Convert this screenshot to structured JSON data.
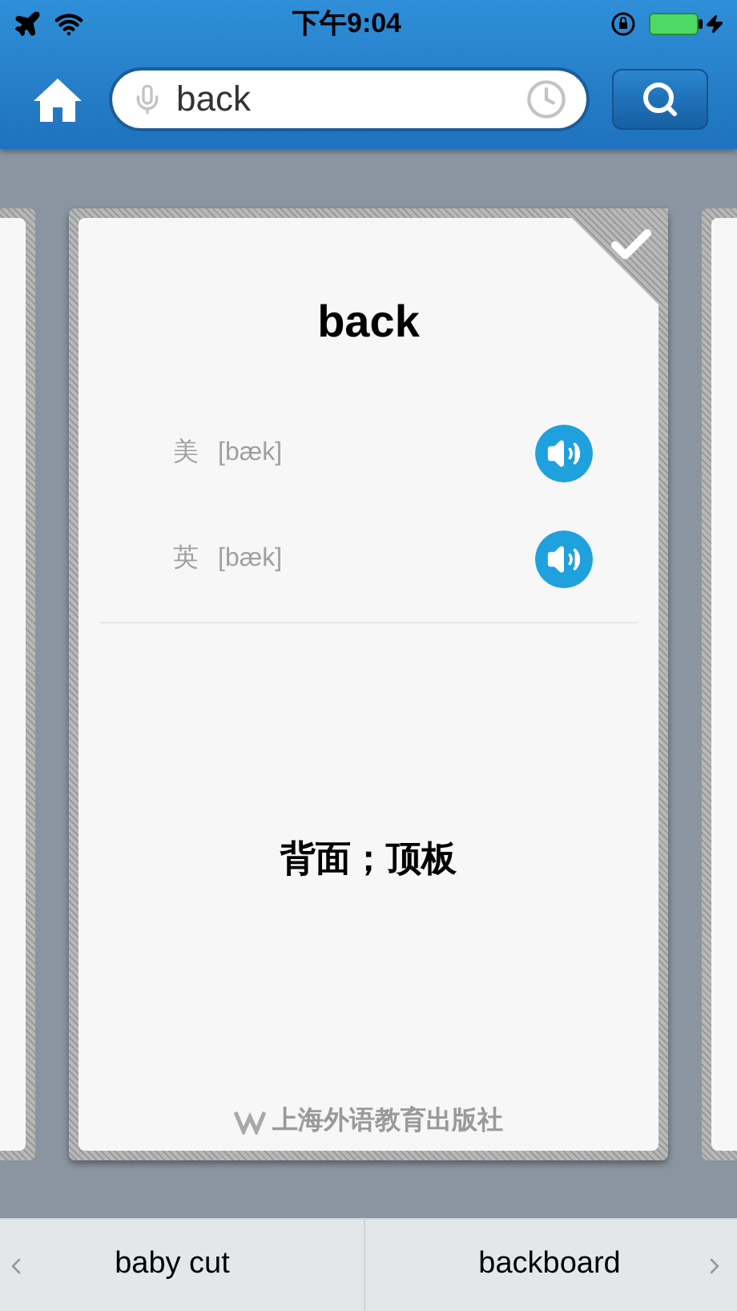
{
  "status_bar": {
    "time": "下午9:04"
  },
  "search": {
    "value": "back"
  },
  "card": {
    "checked": true,
    "word": "back",
    "pronunciations": [
      {
        "region": "美",
        "phonetic": "[bæk]"
      },
      {
        "region": "英",
        "phonetic": "[bæk]"
      }
    ],
    "definition": "背面；顶板",
    "publisher": "上海外语教育出版社"
  },
  "nav": {
    "previous": "baby cut",
    "next": "backboard"
  }
}
